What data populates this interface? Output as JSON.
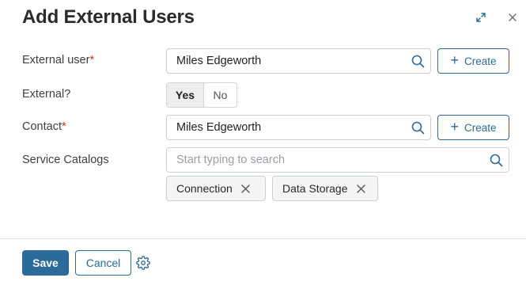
{
  "dialog": {
    "title": "Add External Users",
    "header_icons": [
      "expand-icon",
      "close-icon"
    ]
  },
  "form": {
    "external_user": {
      "label": "External user",
      "required_mark": "*",
      "value": "Miles Edgeworth",
      "create_label": "Create"
    },
    "external": {
      "label": "External?",
      "options": [
        "Yes",
        "No"
      ],
      "selected": "Yes"
    },
    "contact": {
      "label": "Contact",
      "required_mark": "*",
      "value": "Miles Edgeworth",
      "create_label": "Create"
    },
    "service_catalogs": {
      "label": "Service Catalogs",
      "placeholder": "Start typing to search",
      "chips": [
        "Connection",
        "Data Storage"
      ]
    }
  },
  "footer": {
    "save_label": "Save",
    "cancel_label": "Cancel"
  },
  "colors": {
    "accent": "#2b6a99",
    "required": "#d42828"
  }
}
